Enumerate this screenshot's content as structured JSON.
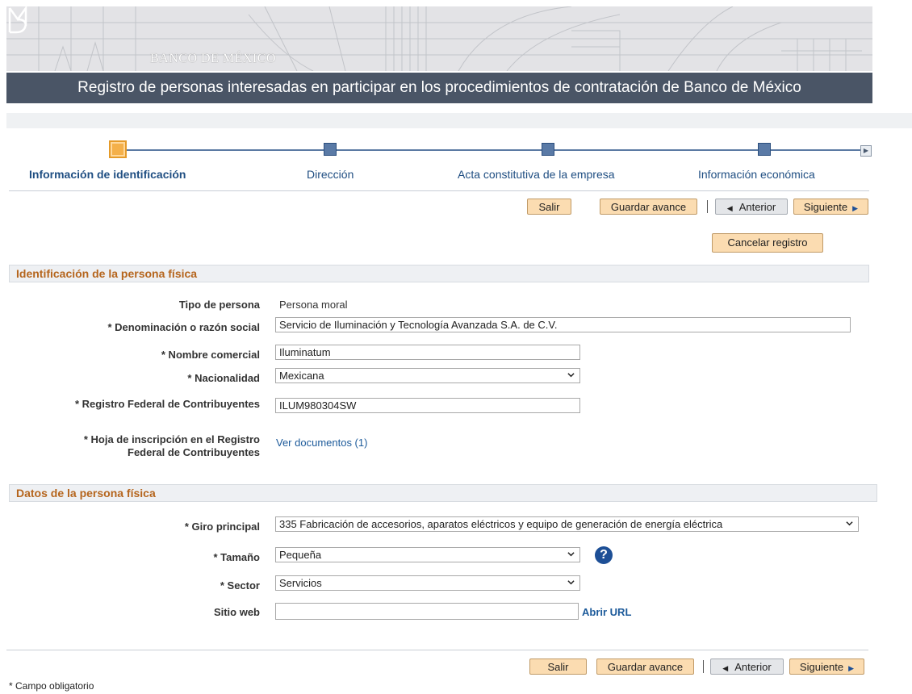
{
  "header": {
    "logo_text": "BANCO DE MÉXICO",
    "title": "Registro de personas interesadas en participar en los procedimientos de contratación de Banco de México"
  },
  "steps": [
    {
      "label": "Información de identificación",
      "active": true
    },
    {
      "label": "Dirección",
      "active": false
    },
    {
      "label": "Acta constitutiva de la empresa",
      "active": false
    },
    {
      "label": "Información económica",
      "active": false
    }
  ],
  "toolbar": {
    "salir": "Salir",
    "guardar": "Guardar avance",
    "anterior": "Anterior",
    "siguiente": "Siguiente",
    "cancelar": "Cancelar registro"
  },
  "section1": {
    "title": "Identificación de la persona física",
    "tipo_label": "Tipo de persona",
    "tipo_value": "Persona moral",
    "denominacion_label": "* Denominación o razón social",
    "denominacion_value": "Servicio de Iluminación y Tecnología Avanzada S.A. de C.V.",
    "nombre_label": "* Nombre comercial",
    "nombre_value": "Iluminatum",
    "nacionalidad_label": "* Nacionalidad",
    "nacionalidad_value": "Mexicana",
    "rfc_label": "* Registro Federal de Contribuyentes",
    "rfc_value": "ILUM980304SW",
    "hoja_label_line1": "* Hoja de inscripción en el Registro",
    "hoja_label_line2": "Federal de Contribuyentes",
    "hoja_link": "Ver documentos (1)"
  },
  "section2": {
    "title": "Datos de la persona física",
    "giro_label": "* Giro principal",
    "giro_value": "335   Fabricación de accesorios, aparatos eléctricos y equipo de generación de energía eléctrica",
    "tamano_label": "* Tamaño",
    "tamano_value": "Pequeña",
    "sector_label": "* Sector",
    "sector_value": "Servicios",
    "sitio_label": "Sitio web",
    "sitio_value": "",
    "abrir_url": "Abrir URL",
    "help_icon": "?"
  },
  "footer": {
    "note": "* Campo obligatorio"
  }
}
